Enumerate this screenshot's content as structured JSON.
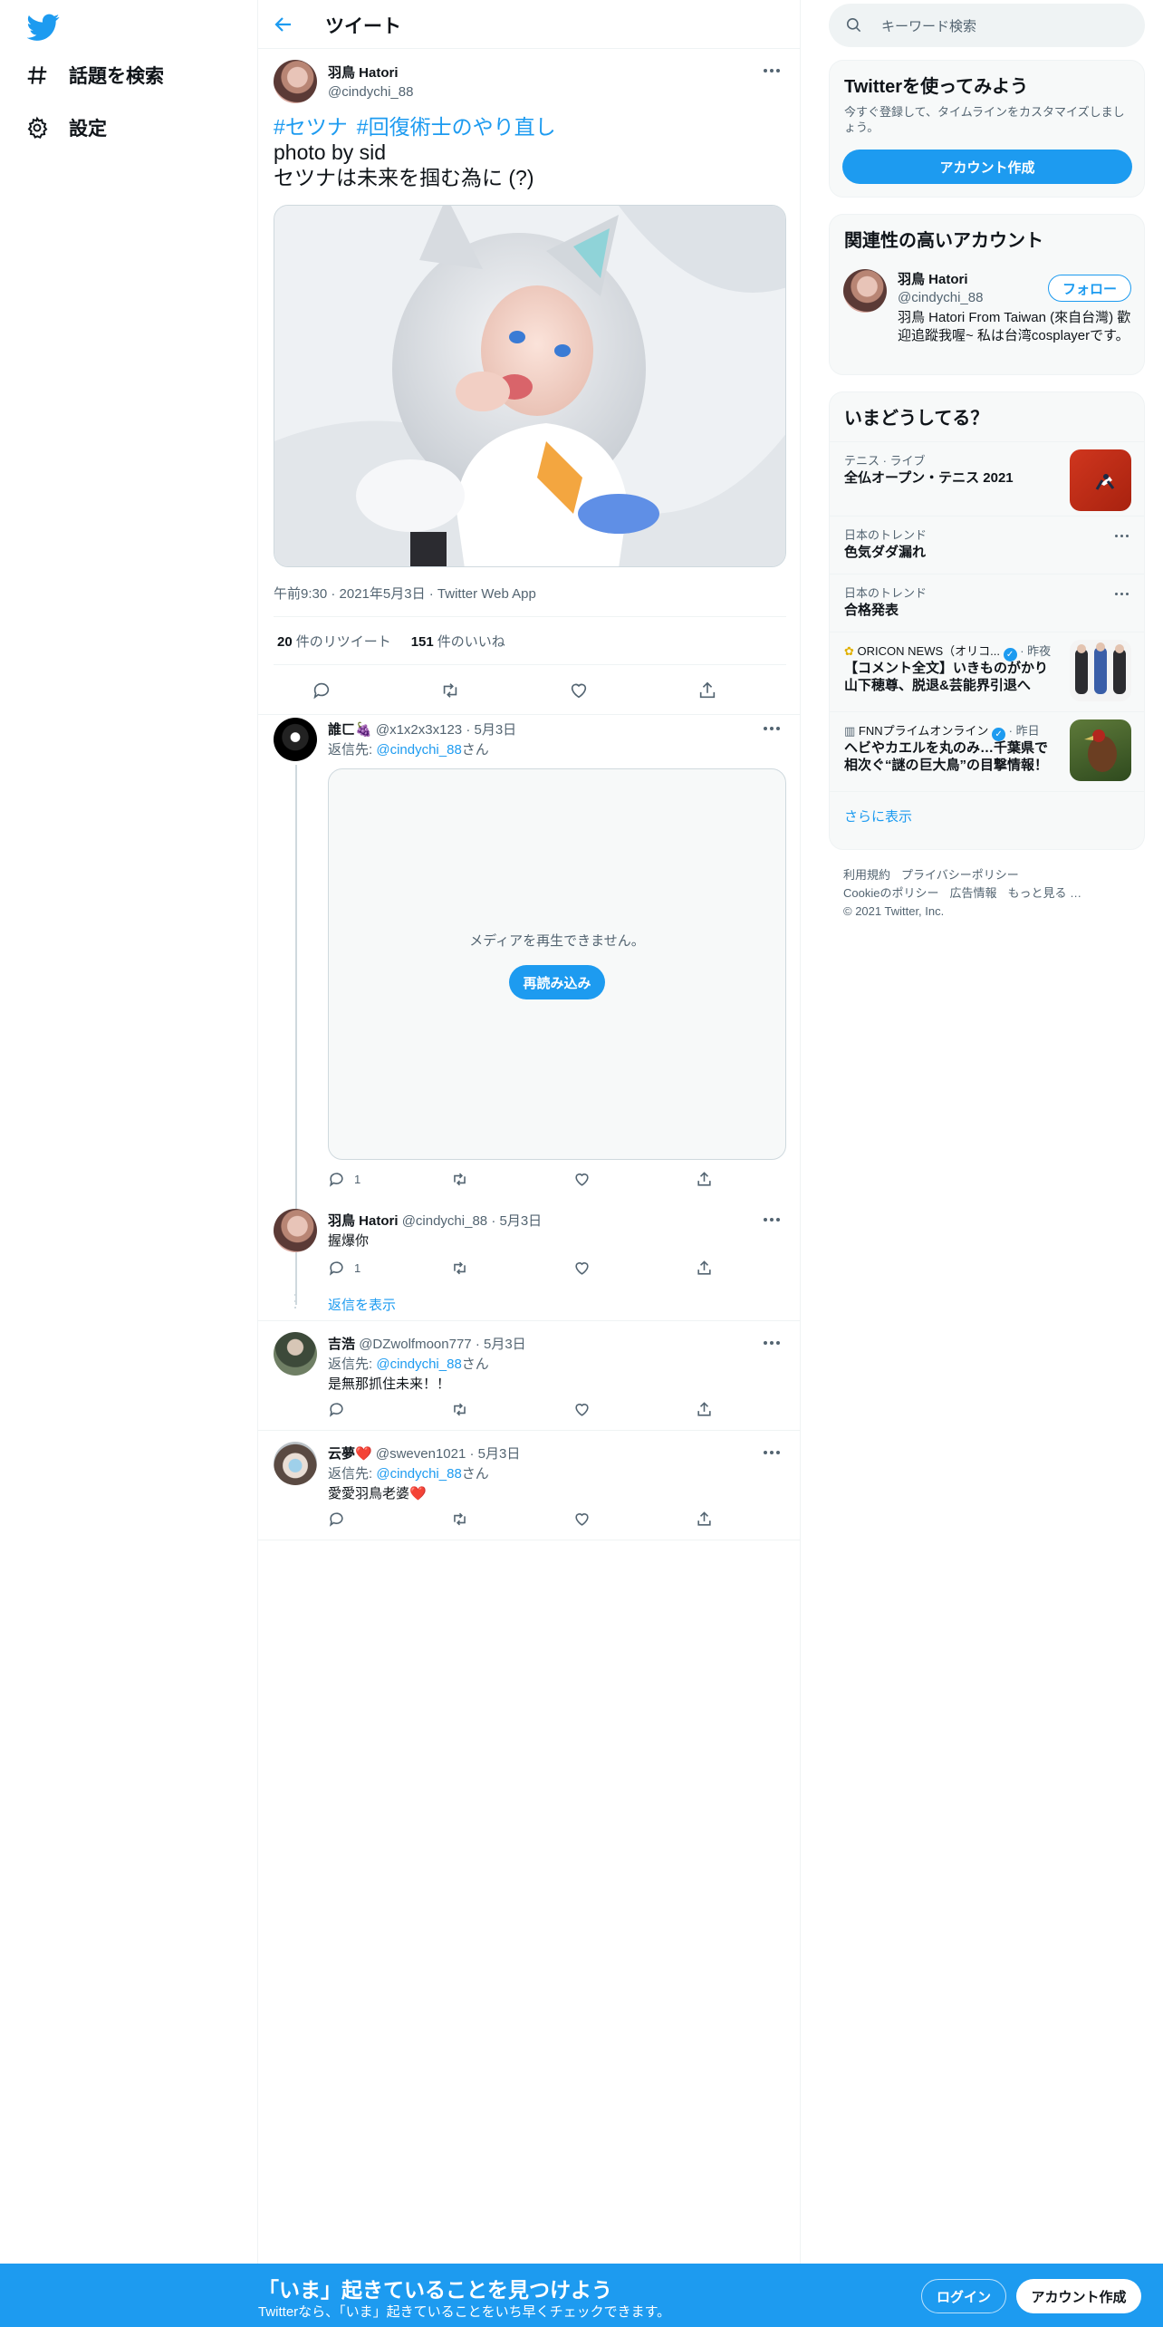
{
  "nav": {
    "logo_icon": "twitter-bird-icon",
    "items": [
      {
        "label": "話題を検索",
        "icon": "hashtag-icon"
      },
      {
        "label": "設定",
        "icon": "gear-icon"
      }
    ]
  },
  "header": {
    "title": "ツイート",
    "back_icon": "arrow-left-icon"
  },
  "tweet": {
    "author_name": "羽鳥 Hatori",
    "author_handle": "@cindychi_88",
    "hashtags": [
      "#セツナ",
      "#回復術士のやり直し"
    ],
    "lines": [
      "photo by sid",
      "セツナは未来を掴む為に (?)"
    ],
    "meta": "午前9:30 · 2021年5月3日 · Twitter Web App",
    "retweets_count": "20",
    "retweets_label": "件のリツイート",
    "likes_count": "151",
    "likes_label": "件のいいね"
  },
  "replies": [
    {
      "name": "誰ㄈ🍇",
      "handle": "@x1x2x3x123",
      "date": "· 5月3日",
      "reply_prefix": "返信先:",
      "reply_to": "@cindychi_88",
      "reply_suffix": "さん",
      "media_message": "メディアを再生できません。",
      "reload_label": "再読み込み",
      "reply_count": "1"
    },
    {
      "name": "羽鳥 Hatori",
      "handle": "@cindychi_88",
      "date": "· 5月3日",
      "text": "握爆你",
      "reply_count": "1",
      "show_replies": "返信を表示"
    },
    {
      "name": "吉浩",
      "handle": "@DZwolfmoon777",
      "date": "· 5月3日",
      "reply_prefix": "返信先:",
      "reply_to": "@cindychi_88",
      "reply_suffix": "さん",
      "text": "是無那抓住未来！！"
    },
    {
      "name": "云夢❤️",
      "handle": "@sweven1021",
      "date": "· 5月3日",
      "reply_prefix": "返信先:",
      "reply_to": "@cindychi_88",
      "reply_suffix": "さん",
      "text": "愛愛羽鳥老婆❤️"
    }
  ],
  "search": {
    "placeholder": "キーワード検索"
  },
  "signup_card": {
    "title": "Twitterを使ってみよう",
    "text": "今すぐ登録して、タイムラインをカスタマイズしましょう。",
    "button": "アカウント作成"
  },
  "related": {
    "title": "関連性の高いアカウント",
    "name": "羽鳥 Hatori",
    "handle": "@cindychi_88",
    "bio": "羽鳥 Hatori From Taiwan (來自台灣) 歡迎追蹤我喔~ 私は台湾cosplayerです。",
    "follow_label": "フォロー"
  },
  "trends": {
    "title": "いまどうしてる？",
    "items": [
      {
        "category": "テニス · ライブ",
        "title": "全仏オープン・テニス 2021"
      },
      {
        "category": "日本のトレンド",
        "title": "色気ダダ漏れ"
      },
      {
        "category": "日本のトレンド",
        "title": "合格発表"
      },
      {
        "source": "ORICON NEWS（オリコ...",
        "time": "· 昨夜",
        "title": "【コメント全文】いきものがかり山下穂尊、脱退&芸能界引退へ"
      },
      {
        "source": "FNNプライムオンライン",
        "time": "· 昨日",
        "title": "ヘビやカエルを丸のみ…千葉県で相次ぐ“謎の巨大鳥”の目撃情報！"
      }
    ],
    "show_more": "さらに表示"
  },
  "footer": {
    "links": [
      "利用規約",
      "プライバシーポリシー",
      "Cookieのポリシー",
      "広告情報",
      "もっと見る …"
    ],
    "copyright": "© 2021 Twitter, Inc."
  },
  "bottom_bar": {
    "title": "「いま」起きていることを見つけよう",
    "subtitle": "Twitterなら、「いま」起きていることをいち早くチェックできます。",
    "login": "ログイン",
    "signup": "アカウント作成"
  },
  "colors": {
    "accent": "#1d9bf0",
    "text": "#0f1419",
    "muted": "#536471"
  }
}
